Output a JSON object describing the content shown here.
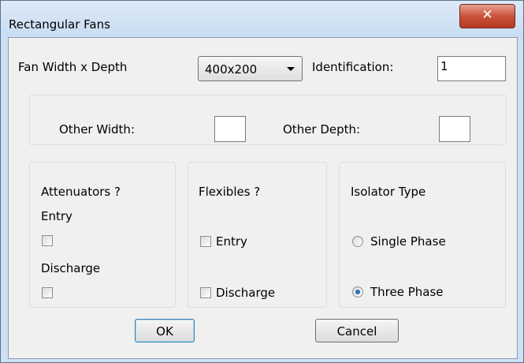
{
  "window": {
    "title": "Rectangular Fans"
  },
  "fan": {
    "size_label": "Fan Width x Depth",
    "size_value": "400x200",
    "identification_label": "Identification:",
    "identification_value": "1"
  },
  "other": {
    "width_label": "Other Width:",
    "width_value": "",
    "depth_label": "Other Depth:",
    "depth_value": ""
  },
  "attenuators": {
    "title": "Attenuators ?",
    "entry_label": "Entry",
    "entry_checked": false,
    "discharge_label": "Discharge",
    "discharge_checked": false
  },
  "flexibles": {
    "title": "Flexibles ?",
    "entry_label": "Entry",
    "entry_checked": false,
    "discharge_label": "Discharge",
    "discharge_checked": false
  },
  "isolator": {
    "title": "Isolator Type",
    "options": [
      "Single Phase",
      "Three Phase"
    ],
    "selected": "Three Phase"
  },
  "buttons": {
    "ok": "OK",
    "cancel": "Cancel"
  },
  "icons": {
    "close": "close-icon"
  }
}
